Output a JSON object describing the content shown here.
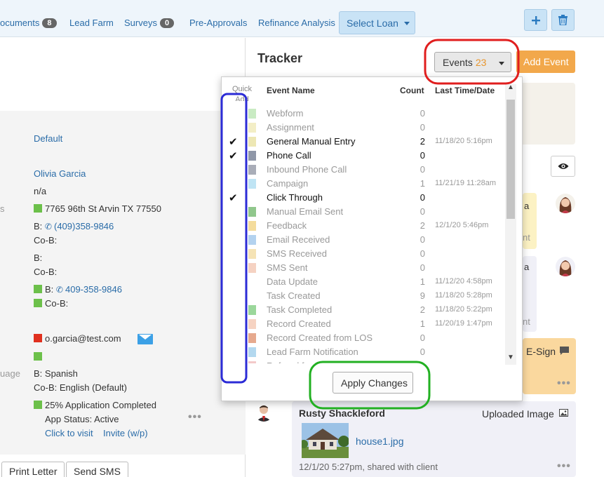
{
  "nav": {
    "documents": {
      "label": "ocuments",
      "count": "8"
    },
    "lead_farm": "Lead Farm",
    "surveys": {
      "label": "Surveys",
      "count": "0"
    },
    "pre_approvals": "Pre-Approvals",
    "refinance": "Refinance Analysis",
    "select_loan": "Select Loan"
  },
  "left": {
    "default": "Default",
    "name": "Olivia Garcia",
    "na": "n/a",
    "label_s": "s",
    "address": "7765 96th St Arvin TX 77550",
    "b_label": "B:",
    "b_phone": "(409)358-9846",
    "cob": "Co-B:",
    "b_empty": "B:",
    "cob2": "Co-B:",
    "b_phone2_label": "B:",
    "b_phone2": "409-358-9846",
    "cob3": "Co-B:",
    "email": "o.garcia@test.com",
    "label_uage": "uage",
    "lang_b": "B: Spanish",
    "lang_cob": "Co-B: English (Default)",
    "app_completed": "25% Application Completed",
    "app_status": "App Status: Active",
    "click_to_visit": "Click to visit",
    "invite": "Invite (w/p)",
    "dots": "•••"
  },
  "bottom": {
    "print_letter": "Print Letter",
    "send_sms": "Send SMS"
  },
  "tracker": {
    "title": "Tracker",
    "events_label": "Events",
    "events_count": "23",
    "add_event": "Add Event",
    "esign": "E-Sign",
    "partial_a1": "a",
    "partial_a2": "a",
    "partial_nt1": "nt",
    "partial_nt2": "nt",
    "dots": "•••",
    "rusty_name": "Rusty Shackleford",
    "uploaded_image": "Uploaded Image",
    "file_name": "house1.jpg",
    "shared": "12/1/20 5:27pm, shared with client"
  },
  "dropdown": {
    "quick_add": "Quick Add",
    "col_event_name": "Event Name",
    "col_count": "Count",
    "col_last": "Last Time/Date",
    "apply": "Apply Changes",
    "check_mark": "✔",
    "events": [
      {
        "name": "Webform",
        "count": "0",
        "date": "",
        "checked": false,
        "color": "#c9ebc3"
      },
      {
        "name": "Assignment",
        "count": "0",
        "date": "",
        "checked": false,
        "color": "#f3eec6"
      },
      {
        "name": "General Manual Entry",
        "count": "2",
        "date": "11/18/20 5:16pm",
        "checked": true,
        "color": "#ede7b4"
      },
      {
        "name": "Phone Call",
        "count": "0",
        "date": "",
        "checked": true,
        "color": "#8f97a8"
      },
      {
        "name": "Inbound Phone Call",
        "count": "0",
        "date": "",
        "checked": false,
        "color": "#a9adb8"
      },
      {
        "name": "Campaign",
        "count": "1",
        "date": "11/21/19 11:28am",
        "checked": false,
        "color": "#bfe4f4"
      },
      {
        "name": "Click Through",
        "count": "0",
        "date": "",
        "checked": true,
        "color": "#ffffff"
      },
      {
        "name": "Manual Email Sent",
        "count": "0",
        "date": "",
        "checked": false,
        "color": "#90c78c"
      },
      {
        "name": "Feedback",
        "count": "2",
        "date": "12/1/20 5:46pm",
        "checked": false,
        "color": "#f4dc9c"
      },
      {
        "name": "Email Received",
        "count": "0",
        "date": "",
        "checked": false,
        "color": "#b3d2ef"
      },
      {
        "name": "SMS Received",
        "count": "0",
        "date": "",
        "checked": false,
        "color": "#f5e3b5"
      },
      {
        "name": "SMS Sent",
        "count": "0",
        "date": "",
        "checked": false,
        "color": "#f5d2c2"
      },
      {
        "name": "Data Update",
        "count": "1",
        "date": "11/12/20 4:58pm",
        "checked": false,
        "color": "#ffffff"
      },
      {
        "name": "Task Created",
        "count": "9",
        "date": "11/18/20 5:28pm",
        "checked": false,
        "color": "#ffffff"
      },
      {
        "name": "Task Completed",
        "count": "2",
        "date": "11/18/20 5:22pm",
        "checked": false,
        "color": "#9bd79b"
      },
      {
        "name": "Record Created",
        "count": "1",
        "date": "11/20/19 1:47pm",
        "checked": false,
        "color": "#f6d3c2"
      },
      {
        "name": "Record Created from LOS",
        "count": "0",
        "date": "",
        "checked": false,
        "color": "#e6a98e"
      },
      {
        "name": "Lead Farm Notification",
        "count": "0",
        "date": "",
        "checked": false,
        "color": "#b3d8ef"
      },
      {
        "name": "Referral f",
        "count": "",
        "date": "",
        "checked": false,
        "color": "#f3c9c9"
      }
    ]
  },
  "highlights": {
    "red": "#e01e1e",
    "blue": "#2b2bd6",
    "green": "#22b022"
  }
}
